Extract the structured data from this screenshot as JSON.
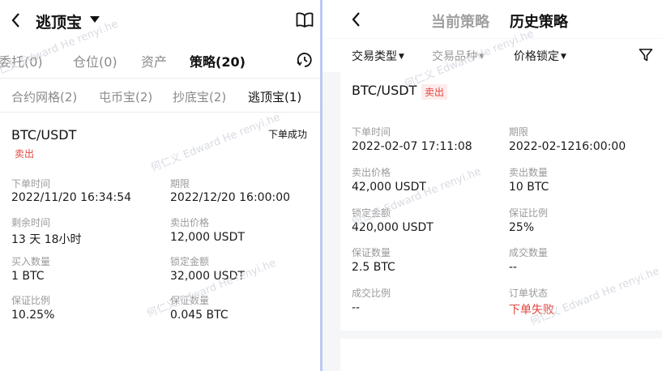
{
  "left": {
    "header": {
      "title": "逃顶宝"
    },
    "tabs": [
      "委托(0)",
      "仓位(0)",
      "资产",
      "策略(20)"
    ],
    "subtabs": [
      "合约网格(2)",
      "屯币宝(2)",
      "抄底宝(2)",
      "逃顶宝(1)"
    ],
    "card": {
      "pair": "BTC/USDT",
      "side": "卖出",
      "status": "下单成功",
      "fields": [
        {
          "label": "下单时间",
          "value": "2022/11/20 16:34:54"
        },
        {
          "label": "期限",
          "value": "2022/12/20 16:00:00"
        },
        {
          "label": "剩余时间",
          "value": "13 天 18小时"
        },
        {
          "label": "卖出价格",
          "value": "12,000 USDT"
        },
        {
          "label": "买入数量",
          "value": "1 BTC"
        },
        {
          "label": "锁定金额",
          "value": "32,000 USDT"
        },
        {
          "label": "保证比例",
          "value": "10.25%"
        },
        {
          "label": "保证数量",
          "value": "0.045 BTC"
        }
      ]
    }
  },
  "right": {
    "header": {
      "tab_current": "当前策略",
      "tab_history": "历史策略"
    },
    "filters": {
      "type": "交易类型",
      "product": "交易品种",
      "price_lock": "价格锁定"
    },
    "card": {
      "pair": "BTC/USDT",
      "side": "卖出",
      "fields": [
        {
          "label": "下单时间",
          "value": "2022-02-07 17:11:08"
        },
        {
          "label": "期限",
          "value": "2022-02-1216:00:00"
        },
        {
          "label": "卖出价格",
          "value": "42,000 USDT"
        },
        {
          "label": "卖出数量",
          "value": "10 BTC"
        },
        {
          "label": "锁定金额",
          "value": "420,000 USDT"
        },
        {
          "label": "保证比例",
          "value": "25%"
        },
        {
          "label": "保证数量",
          "value": "2.5 BTC"
        },
        {
          "label": "成交数量",
          "value": "--"
        },
        {
          "label": "成交比例",
          "value": "--"
        },
        {
          "label": "订单状态",
          "value": "下单失败"
        }
      ]
    }
  },
  "watermark": "何仁义 Edward He renyi.he",
  "colors": {
    "sell_red": "#e0463f",
    "divider_blue": "#b9c9f0"
  }
}
